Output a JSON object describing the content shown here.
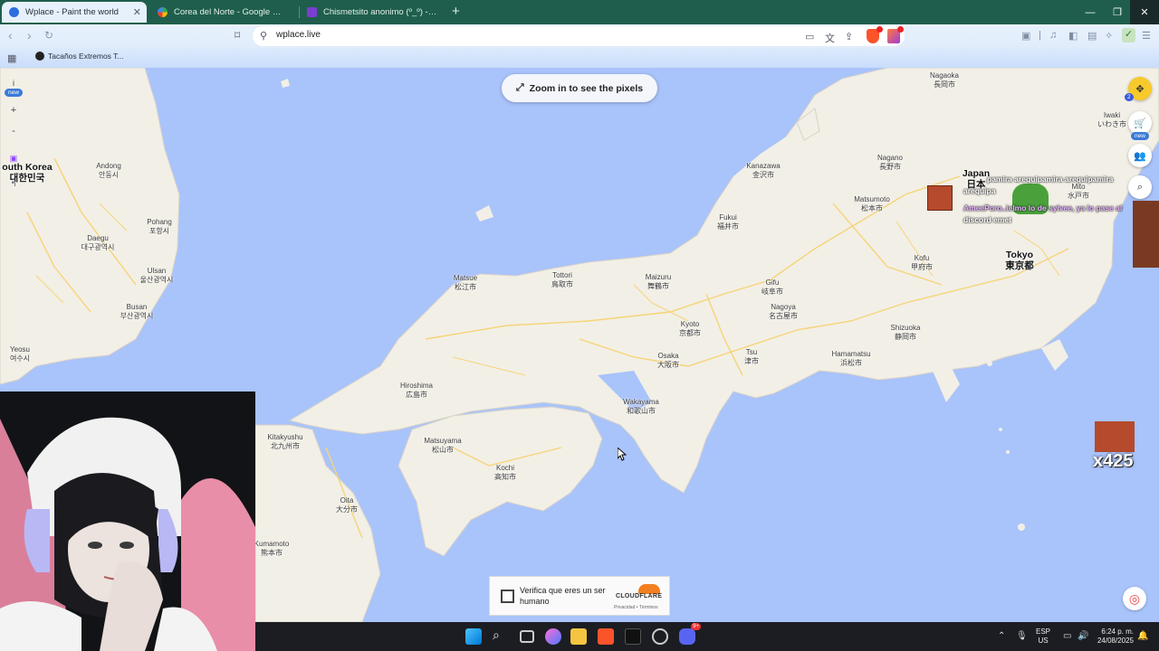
{
  "browser": {
    "tabs": [
      {
        "title": "Wplace - Paint the world",
        "active": true
      },
      {
        "title": "Corea del Norte - Google Maps",
        "active": false
      },
      {
        "title": "Chismetsito anonimo (º_º) - Form",
        "active": false
      }
    ],
    "url": "wplace.live",
    "bookmark": "Tacaños Extremos T..."
  },
  "map": {
    "zoom_prompt": "Zoom in to see the pixels",
    "left_controls": {
      "info": "i",
      "new_badge": "new",
      "zoom_in": "+",
      "zoom_out": "-"
    },
    "right_new_badge": "new",
    "right_count_badge": "2",
    "labels": [
      {
        "id": "south-korea",
        "name": "outh Korea",
        "local": "대한민국",
        "big": true
      },
      {
        "id": "andong",
        "name": "Andong",
        "local": "안동시"
      },
      {
        "id": "pohang",
        "name": "Pohang",
        "local": "포항시"
      },
      {
        "id": "daegu",
        "name": "Daegu",
        "local": "대구광역시"
      },
      {
        "id": "ulsan",
        "name": "Ulsan",
        "local": "울산광역시"
      },
      {
        "id": "busan",
        "name": "Busan",
        "local": "부산광역시"
      },
      {
        "id": "yeosu",
        "name": "Yeosu",
        "local": "여수시"
      },
      {
        "id": "matsue",
        "name": "Matsue",
        "local": "松江市"
      },
      {
        "id": "tottori",
        "name": "Tottori",
        "local": "鳥取市"
      },
      {
        "id": "maizuru",
        "name": "Maizuru",
        "local": "舞鶴市"
      },
      {
        "id": "fukui",
        "name": "Fukui",
        "local": "福井市"
      },
      {
        "id": "kanazawa",
        "name": "Kanazawa",
        "local": "金沢市"
      },
      {
        "id": "nagaoka",
        "name": "Nagaoka",
        "local": "長岡市"
      },
      {
        "id": "iwaki",
        "name": "Iwaki",
        "local": "いわき市"
      },
      {
        "id": "nagano",
        "name": "Nagano",
        "local": "長野市"
      },
      {
        "id": "japan",
        "name": "Japan",
        "local": "日本",
        "big": true
      },
      {
        "id": "matsumoto",
        "name": "Matsumoto",
        "local": "松本市"
      },
      {
        "id": "mito",
        "name": "Mito",
        "local": "水戸市"
      },
      {
        "id": "gifu",
        "name": "Gifu",
        "local": "岐阜市"
      },
      {
        "id": "kyoto",
        "name": "Kyoto",
        "local": "京都市"
      },
      {
        "id": "nagoya",
        "name": "Nagoya",
        "local": "名古屋市"
      },
      {
        "id": "kofu",
        "name": "Kofu",
        "local": "甲府市"
      },
      {
        "id": "tokyo",
        "name": "Tokyo",
        "local": "東京都",
        "big": true
      },
      {
        "id": "osaka",
        "name": "Osaka",
        "local": "大阪市"
      },
      {
        "id": "tsu",
        "name": "Tsu",
        "local": "津市"
      },
      {
        "id": "shizuoka",
        "name": "Shizuoka",
        "local": "静岡市"
      },
      {
        "id": "hamamatsu",
        "name": "Hamamatsu",
        "local": "浜松市"
      },
      {
        "id": "hiroshima",
        "name": "Hiroshima",
        "local": "広島市"
      },
      {
        "id": "wakayama",
        "name": "Wakayama",
        "local": "和歌山市"
      },
      {
        "id": "kitakyushu",
        "name": "Kitakyushu",
        "local": "北九州市"
      },
      {
        "id": "matsuyama",
        "name": "Matsuyama",
        "local": "松山市"
      },
      {
        "id": "kochi",
        "name": "Kochi",
        "local": "高知市"
      },
      {
        "id": "oita",
        "name": "Oita",
        "local": "大分市"
      },
      {
        "id": "kumamoto",
        "name": "Kumamoto",
        "local": "熊本市"
      }
    ],
    "chat_lines": [
      "pamira arequipamira arequipamira",
      "arequipa",
      "AmeePoro..ielmo lo de sylvee, ya lo pase al",
      "discord emet"
    ],
    "pixel_counter": "x425"
  },
  "captcha": {
    "label": "Verifica que eres un ser humano",
    "brand": "CLOUDFLARE",
    "privacy": "Privacidad",
    "sep": "•",
    "terms": "Términos"
  },
  "taskbar": {
    "lang_line1": "ESP",
    "lang_line2": "US",
    "time": "6:24 p. m.",
    "date": "24/08/2025",
    "notify_count": "9+"
  },
  "colors": {
    "water": "#a9c3fb",
    "land": "#f2efe6",
    "tabstrip": "#1f5e4d",
    "taskbar": "#1b1d22",
    "cloudflare": "#f38020"
  }
}
